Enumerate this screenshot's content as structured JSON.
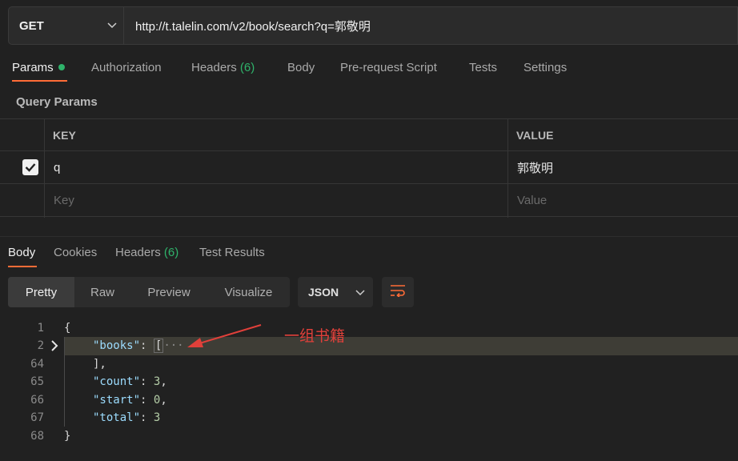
{
  "request": {
    "method": "GET",
    "url": "http://t.talelin.com/v2/book/search?q=郭敬明"
  },
  "request_tabs": {
    "params": "Params",
    "authorization": "Authorization",
    "headers": "Headers",
    "headers_count": "(6)",
    "body": "Body",
    "pre_request": "Pre-request Script",
    "tests": "Tests",
    "settings": "Settings"
  },
  "query_params": {
    "title": "Query Params",
    "headers": {
      "key": "KEY",
      "value": "VALUE"
    },
    "rows": [
      {
        "checked": true,
        "key": "q",
        "value": "郭敬明"
      }
    ],
    "placeholder": {
      "key": "Key",
      "value": "Value"
    }
  },
  "response_tabs": {
    "body": "Body",
    "cookies": "Cookies",
    "headers": "Headers",
    "headers_count": "(6)",
    "test_results": "Test Results"
  },
  "view_modes": {
    "pretty": "Pretty",
    "raw": "Raw",
    "preview": "Preview",
    "visualize": "Visualize",
    "format": "JSON"
  },
  "code": {
    "line_numbers": [
      "1",
      "2",
      "64",
      "65",
      "66",
      "67",
      "68"
    ],
    "open_brace": "{",
    "books_key": "\"books\"",
    "books_open": "[",
    "books_ellipsis": "···",
    "books_close": "],",
    "count_key": "\"count\"",
    "count_value": "3",
    "start_key": "\"start\"",
    "start_value": "0",
    "total_key": "\"total\"",
    "total_value": "3",
    "close_brace": "}"
  },
  "annotation": "一组书籍",
  "colors": {
    "accent": "#ff6c37",
    "success": "#2fb36b",
    "annotation": "#e0403a"
  }
}
